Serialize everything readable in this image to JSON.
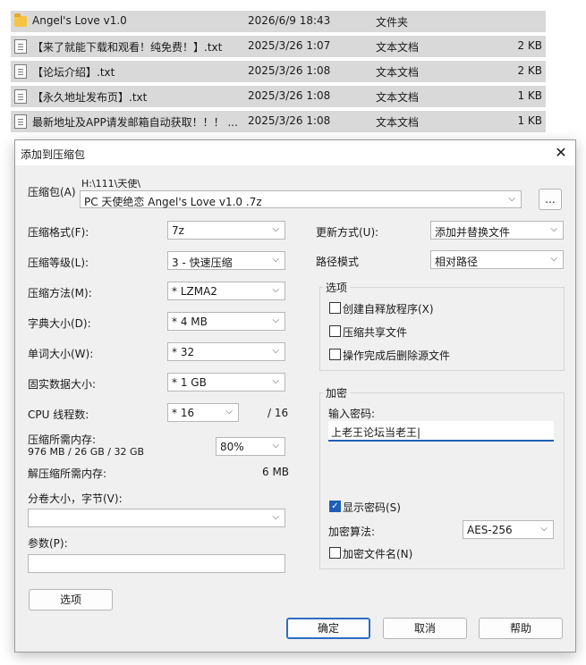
{
  "files": [
    {
      "icon": "folder-icon",
      "name": "Angel's Love v1.0",
      "date": "2026/6/9 18:43",
      "type": "文件夹",
      "size": ""
    },
    {
      "icon": "text-file-icon",
      "name": "【来了就能下载和观看！纯免费！】.txt",
      "date": "2025/3/26 1:07",
      "type": "文本文档",
      "size": "2 KB"
    },
    {
      "icon": "text-file-icon",
      "name": "【论坛介绍】.txt",
      "date": "2025/3/26 1:08",
      "type": "文本文档",
      "size": "2 KB"
    },
    {
      "icon": "text-file-icon",
      "name": "【永久地址发布页】.txt",
      "date": "2025/3/26 1:08",
      "type": "文本文档",
      "size": "1 KB"
    },
    {
      "icon": "text-file-icon",
      "name": "最新地址及APP请发邮箱自动获取！！！ ...",
      "date": "2025/3/26 1:08",
      "type": "文本文档",
      "size": "1 KB"
    }
  ],
  "dialog": {
    "title": "添加到压缩包",
    "close": "✕",
    "archive_label": "压缩包(A)",
    "archive_path": "H:\\111\\天使\\",
    "archive_name": "PC 天使绝恋 Angel's Love v1.0 .7z",
    "browse": "...",
    "format_label": "压缩格式(F):",
    "format_value": "7z",
    "level_label": "压缩等级(L):",
    "level_value": "3 - 快速压缩",
    "method_label": "压缩方法(M):",
    "method_value": "*  LZMA2",
    "dict_label": "字典大小(D):",
    "dict_value": "*  4 MB",
    "word_label": "单词大小(W):",
    "word_value": "*  32",
    "solid_label": "固实数据大小:",
    "solid_value": "*  1 GB",
    "cpu_label": "CPU 线程数:",
    "cpu_value": "*  16",
    "cpu_total": "/ 16",
    "mem_label": "压缩所需内存:",
    "mem_detail": "976 MB / 26 GB / 32 GB",
    "mem_value": "80%",
    "decomp_label": "解压缩所需内存:",
    "decomp_value": "6 MB",
    "split_label": "分卷大小，字节(V):",
    "split_value": "",
    "params_label": "参数(P):",
    "params_value": "",
    "options_button": "选项",
    "update_label": "更新方式(U):",
    "update_value": "添加并替换文件",
    "path_label": "路径模式",
    "path_value": "相对路径",
    "options_group": "选项",
    "opt_sfx": "创建自释放程序(X)",
    "opt_shared": "压缩共享文件",
    "opt_delete": "操作完成后删除源文件",
    "encrypt_group": "加密",
    "password_label": "输入密码:",
    "password_value": "上老王论坛当老王|",
    "show_password": "显示密码(S)",
    "enc_method_label": "加密算法:",
    "enc_method_value": "AES-256",
    "encrypt_names": "加密文件名(N)",
    "ok": "确定",
    "cancel": "取消",
    "help": "帮助"
  }
}
